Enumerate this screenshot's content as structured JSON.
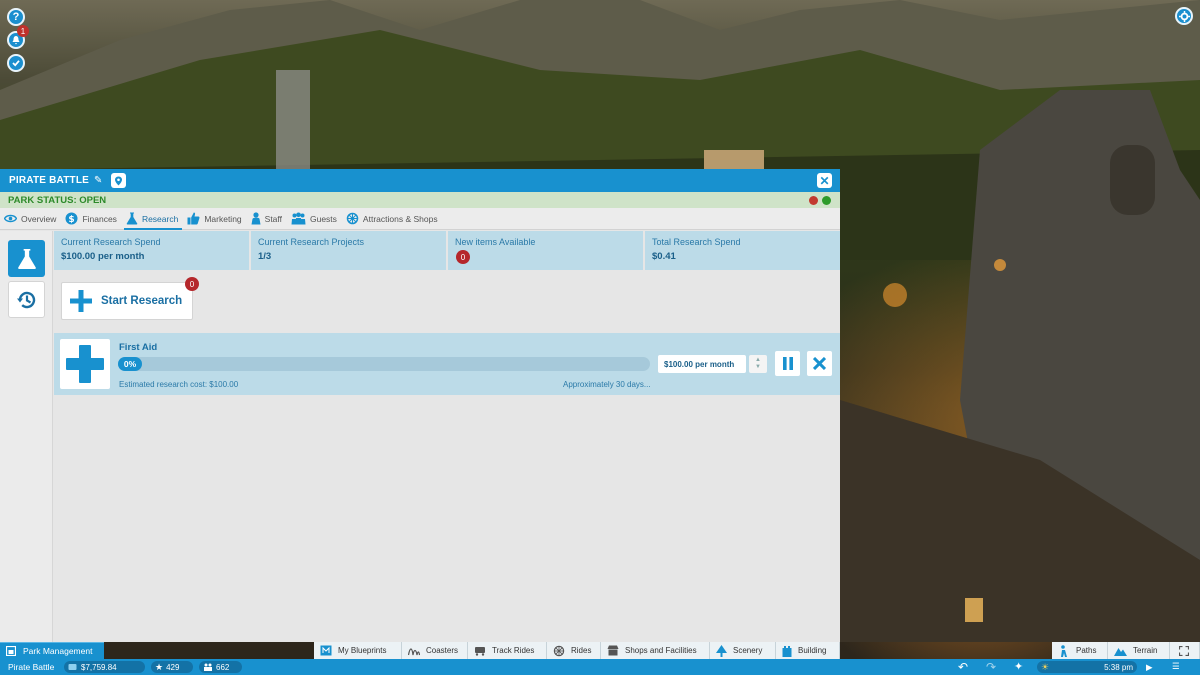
{
  "park": {
    "name": "PIRATE BATTLE",
    "status": "PARK STATUS: OPEN"
  },
  "tabs": [
    {
      "label": "Overview",
      "icon": "eye-icon"
    },
    {
      "label": "Finances",
      "icon": "dollar-icon"
    },
    {
      "label": "Research",
      "icon": "flask-icon",
      "active": true
    },
    {
      "label": "Marketing",
      "icon": "thumbs-up-icon"
    },
    {
      "label": "Staff",
      "icon": "staff-icon"
    },
    {
      "label": "Guests",
      "icon": "guests-icon"
    },
    {
      "label": "Attractions & Shops",
      "icon": "gear-icon"
    }
  ],
  "notifications": {
    "count": "1"
  },
  "stats": {
    "current_spend_label": "Current Research Spend",
    "current_spend_value": "$100.00 per month",
    "projects_label": "Current Research Projects",
    "projects_value": "1/3",
    "new_items_label": "New items Available",
    "new_items_value": "0",
    "total_spend_label": "Total Research Spend",
    "total_spend_value": "$0.41"
  },
  "start_research": {
    "label": "Start Research",
    "badge": "0"
  },
  "project": {
    "name": "First Aid",
    "progress_text": "0%",
    "progress": 0,
    "cost": "Estimated research cost: $100.00",
    "time": "Approximately 30 days...",
    "spend": "$100.00 per month"
  },
  "toolbar": {
    "park_management": "Park Management",
    "items": [
      {
        "label": "My Blueprints",
        "icon": "blueprint-icon"
      },
      {
        "label": "Coasters",
        "icon": "coaster-icon"
      },
      {
        "label": "Track Rides",
        "icon": "track-ride-icon"
      },
      {
        "label": "Rides",
        "icon": "ferris-wheel-icon"
      },
      {
        "label": "Shops and Facilities",
        "icon": "shop-icon"
      },
      {
        "label": "Scenery",
        "icon": "tree-icon"
      },
      {
        "label": "Building",
        "icon": "building-icon"
      }
    ],
    "paths": "Paths",
    "terrain": "Terrain"
  },
  "status_bar": {
    "park_name": "Pirate Battle",
    "money": "$7,759.84",
    "rating": "429",
    "guests": "662",
    "time": "5:38 pm"
  },
  "colors": {
    "accent": "#1891cf",
    "status_open": "#2d8a2a",
    "badge_red": "#b5272b"
  }
}
